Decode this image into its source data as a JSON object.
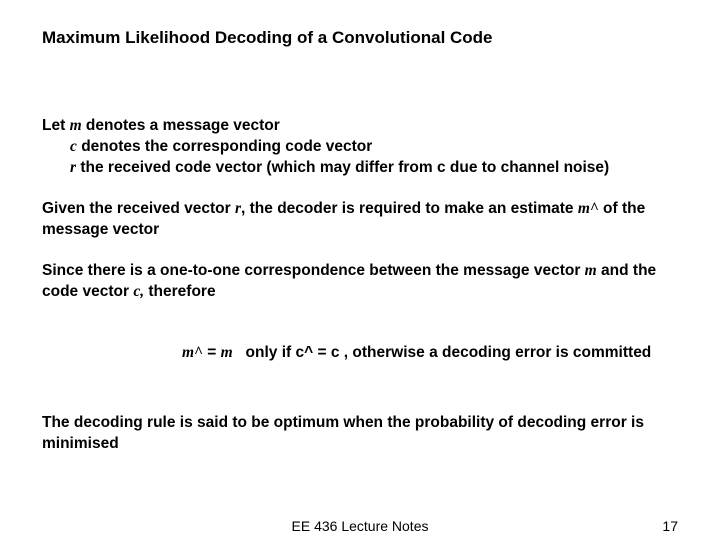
{
  "title": "Maximum Likelihood Decoding of a Convolutional Code",
  "p1_a": "Let ",
  "p1_m": "m",
  "p1_b": " denotes a message vector",
  "p1_c": "c",
  "p1_d": " denotes the corresponding code vector",
  "p1_r": "r",
  "p1_e": " the received code vector (which may differ from c due to channel noise)",
  "p2_a": "Given the received vector ",
  "p2_r": "r",
  "p2_b": ", the decoder is required to make an estimate ",
  "p2_mh": "m^",
  "p2_c": " of the message vector",
  "p3_a": "Since there is a one-to-one correspondence between the message vector ",
  "p3_m": "m",
  "p3_b": " and the code vector ",
  "p3_c": "c,",
  "p3_d": " therefore",
  "p4_mh": "m^",
  "p4_eq1": " = ",
  "p4_m": "m",
  "p4_mid": "   only if ",
  "p4_ch": "c^",
  "p4_eq2": " = ",
  "p4_c": "c",
  "p4_tail": " , otherwise a decoding error is committed",
  "p5": "The decoding rule is said to be optimum when the probability of decoding error is minimised",
  "footer_center": "EE 436 Lecture Notes",
  "footer_right": "17"
}
